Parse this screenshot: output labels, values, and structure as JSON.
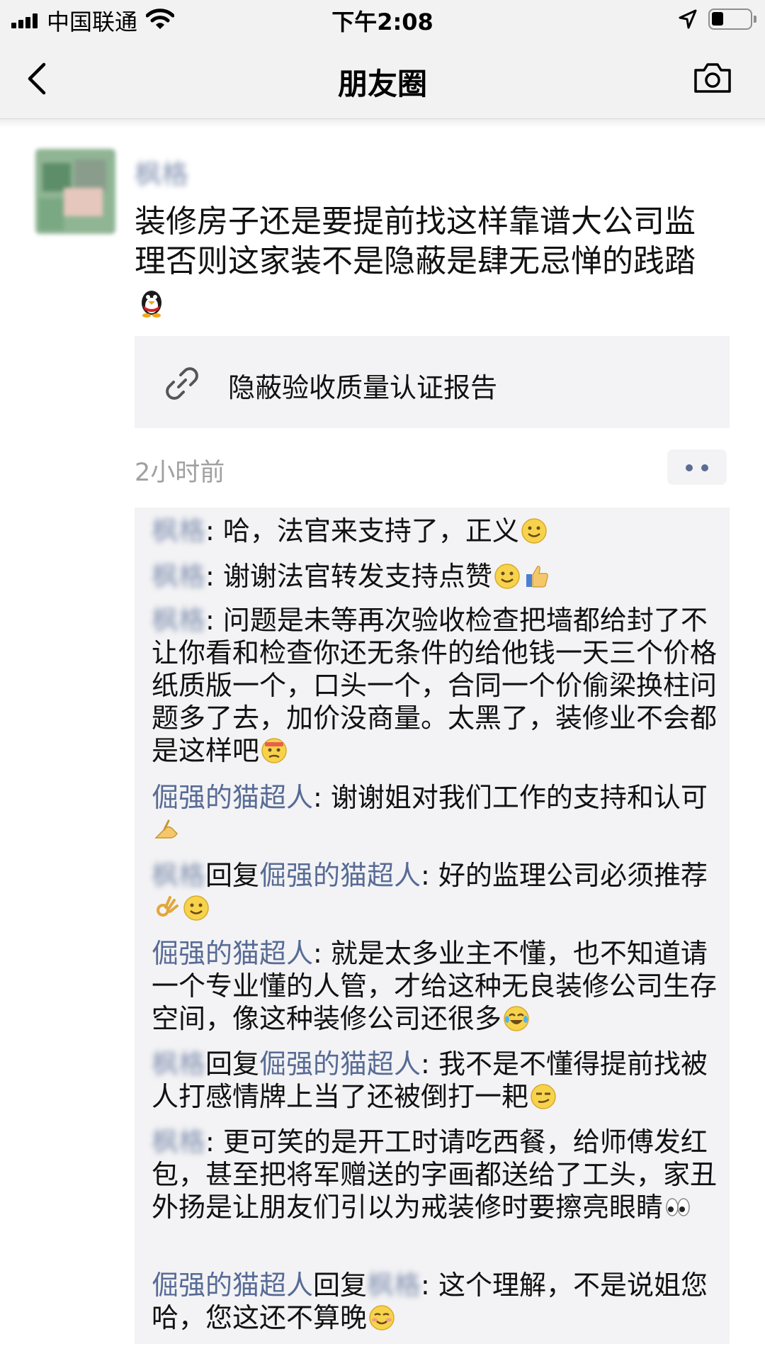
{
  "status_bar": {
    "carrier": "中国联通",
    "time": "下午2:08"
  },
  "nav": {
    "title": "朋友圈"
  },
  "post": {
    "author": "枫格",
    "text_line1": "装修房子还是要提前找这样靠谱大公司监",
    "text_line2": "理否则这家装不是隐蔽是肆无忌惮的践踏",
    "link_title": "隐蔽验收质量认证报告",
    "timestamp": "2小时前"
  },
  "comments": [
    {
      "author": "枫格",
      "sep": ": ",
      "text": "哈，法官来支持了，正义"
    },
    {
      "author": "枫格",
      "sep": ": ",
      "text": "谢谢法官转发支持点赞"
    },
    {
      "author": "枫格",
      "sep": ": ",
      "text": "问题是未等再次验收检查把墙都给封了不让你看和检查你还无条件的给他钱一天三个价格纸质版一个，口头一个，合同一个价偷梁换柱问题多了去，加价没商量。太黑了，装修业不会都是这样吧"
    },
    {
      "author": "倔强的猫超人",
      "sep": ": ",
      "text": "谢谢姐对我们工作的支持和认可"
    },
    {
      "author": "枫格",
      "reply_word": "回复",
      "reply_to": "倔强的猫超人",
      "sep": ": ",
      "text": "好的监理公司必须推荐"
    },
    {
      "author": "倔强的猫超人",
      "sep": ": ",
      "text": "就是太多业主不懂，也不知道请一个专业懂的人管，才给这种无良装修公司生存空间，像这种装修公司还很多"
    },
    {
      "author": "枫格",
      "reply_word": "回复",
      "reply_to": "倔强的猫超人",
      "sep": ": ",
      "text": "我不是不懂得提前找被人打感情牌上当了还被倒打一耙"
    },
    {
      "author": "枫格",
      "sep": ": ",
      "text": "更可笑的是开工时请吃西餐，给师傅发红包，甚至把将军赠送的字画都送给了工头，家丑外扬是让朋友们引以为戒装修时要擦亮眼睛"
    },
    {
      "author": "倔强的猫超人",
      "reply_word": "回复",
      "reply_to": "枫格",
      "sep": ": ",
      "text": "这个理解，不是说姐您哈，您这还不算晚"
    }
  ],
  "icons": [
    "signal-icon",
    "wifi-icon",
    "location-icon",
    "battery-icon",
    "back-icon",
    "camera-icon",
    "link-icon",
    "more-dots-icon"
  ],
  "colors": {
    "name_blue": "#576b95",
    "panel": "#f3f3f5",
    "navbar": "#f2f2f2"
  }
}
